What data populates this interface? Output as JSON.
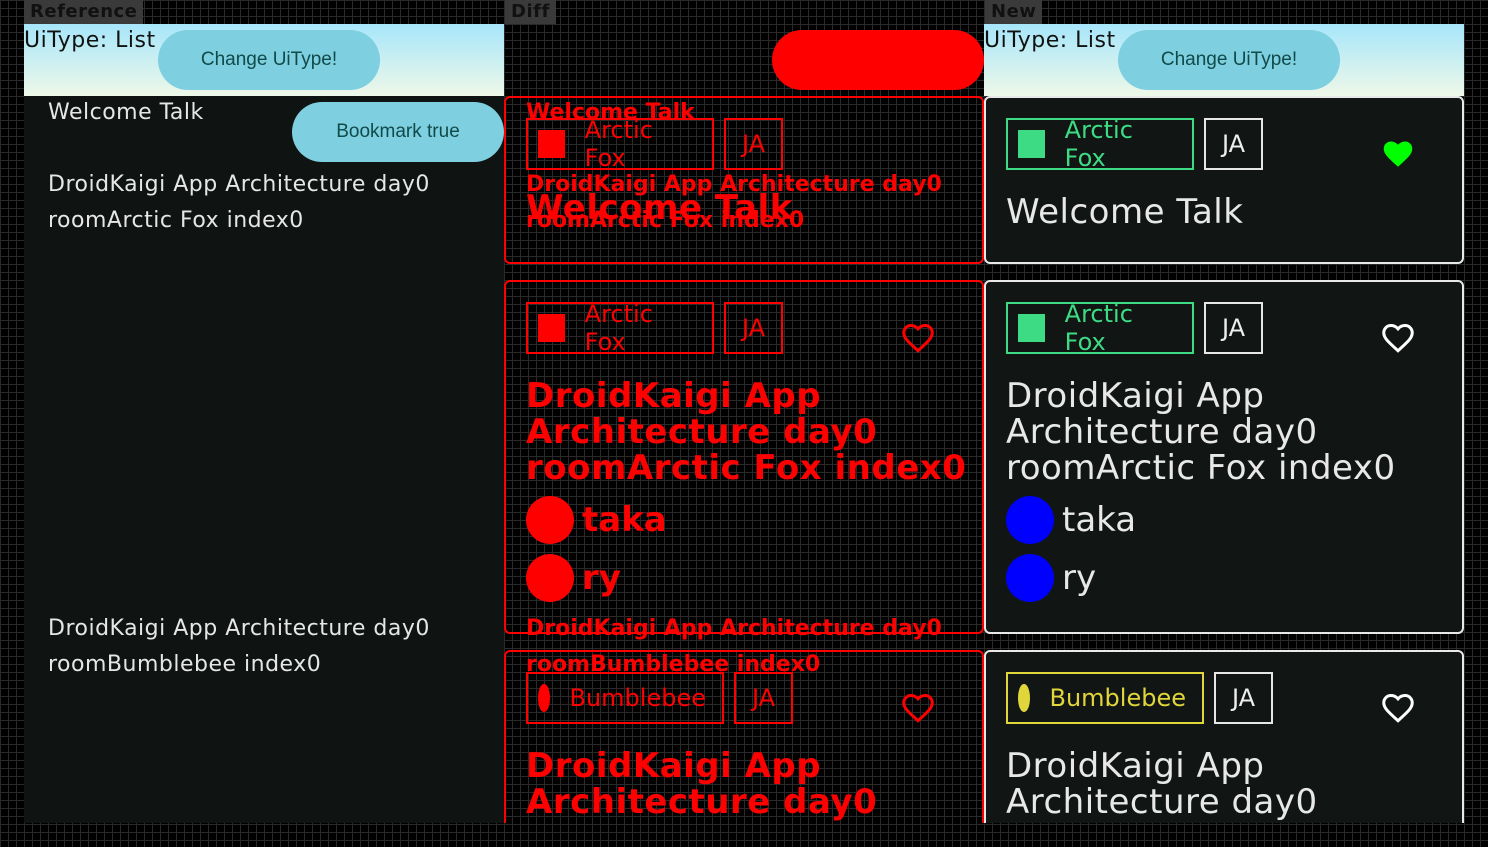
{
  "labels": {
    "reference": "Reference",
    "diff": "Diff",
    "new": "New"
  },
  "appbar": {
    "title": "UiType: List",
    "button": "Change UiType!"
  },
  "reference": {
    "bookmark_button": "Bookmark true",
    "session_1_title": "Welcome Talk",
    "session_2_line1": "DroidKaigi App Architecture day0",
    "session_2_line2": "roomArctic Fox index0",
    "session_3_line1": "DroidKaigi App Architecture day0",
    "session_3_line2": "roomBumblebee index0"
  },
  "cards": [
    {
      "room": "Arctic Fox",
      "lang": "JA",
      "bookmarked": true,
      "title_lines": [
        "Welcome Talk"
      ],
      "speakers": []
    },
    {
      "room": "Arctic Fox",
      "lang": "JA",
      "bookmarked": false,
      "title_lines": [
        "DroidKaigi App",
        "Architecture day0",
        "roomArctic Fox index0"
      ],
      "speakers": [
        "taka",
        "ry"
      ]
    },
    {
      "room": "Bumblebee",
      "lang": "JA",
      "bookmarked": false,
      "title_lines": [
        "DroidKaigi App",
        "Architecture day0"
      ],
      "speakers": []
    }
  ],
  "colors": {
    "arctic_fox": "#3ddc84",
    "bumblebee": "#e0d53a",
    "bookmark_on": "#00ff00",
    "avatar": "#0000ff",
    "diff": "#ff0000"
  },
  "icons": {
    "bookmarked": "heart-filled-icon",
    "not_bookmarked": "heart-outline-icon"
  }
}
